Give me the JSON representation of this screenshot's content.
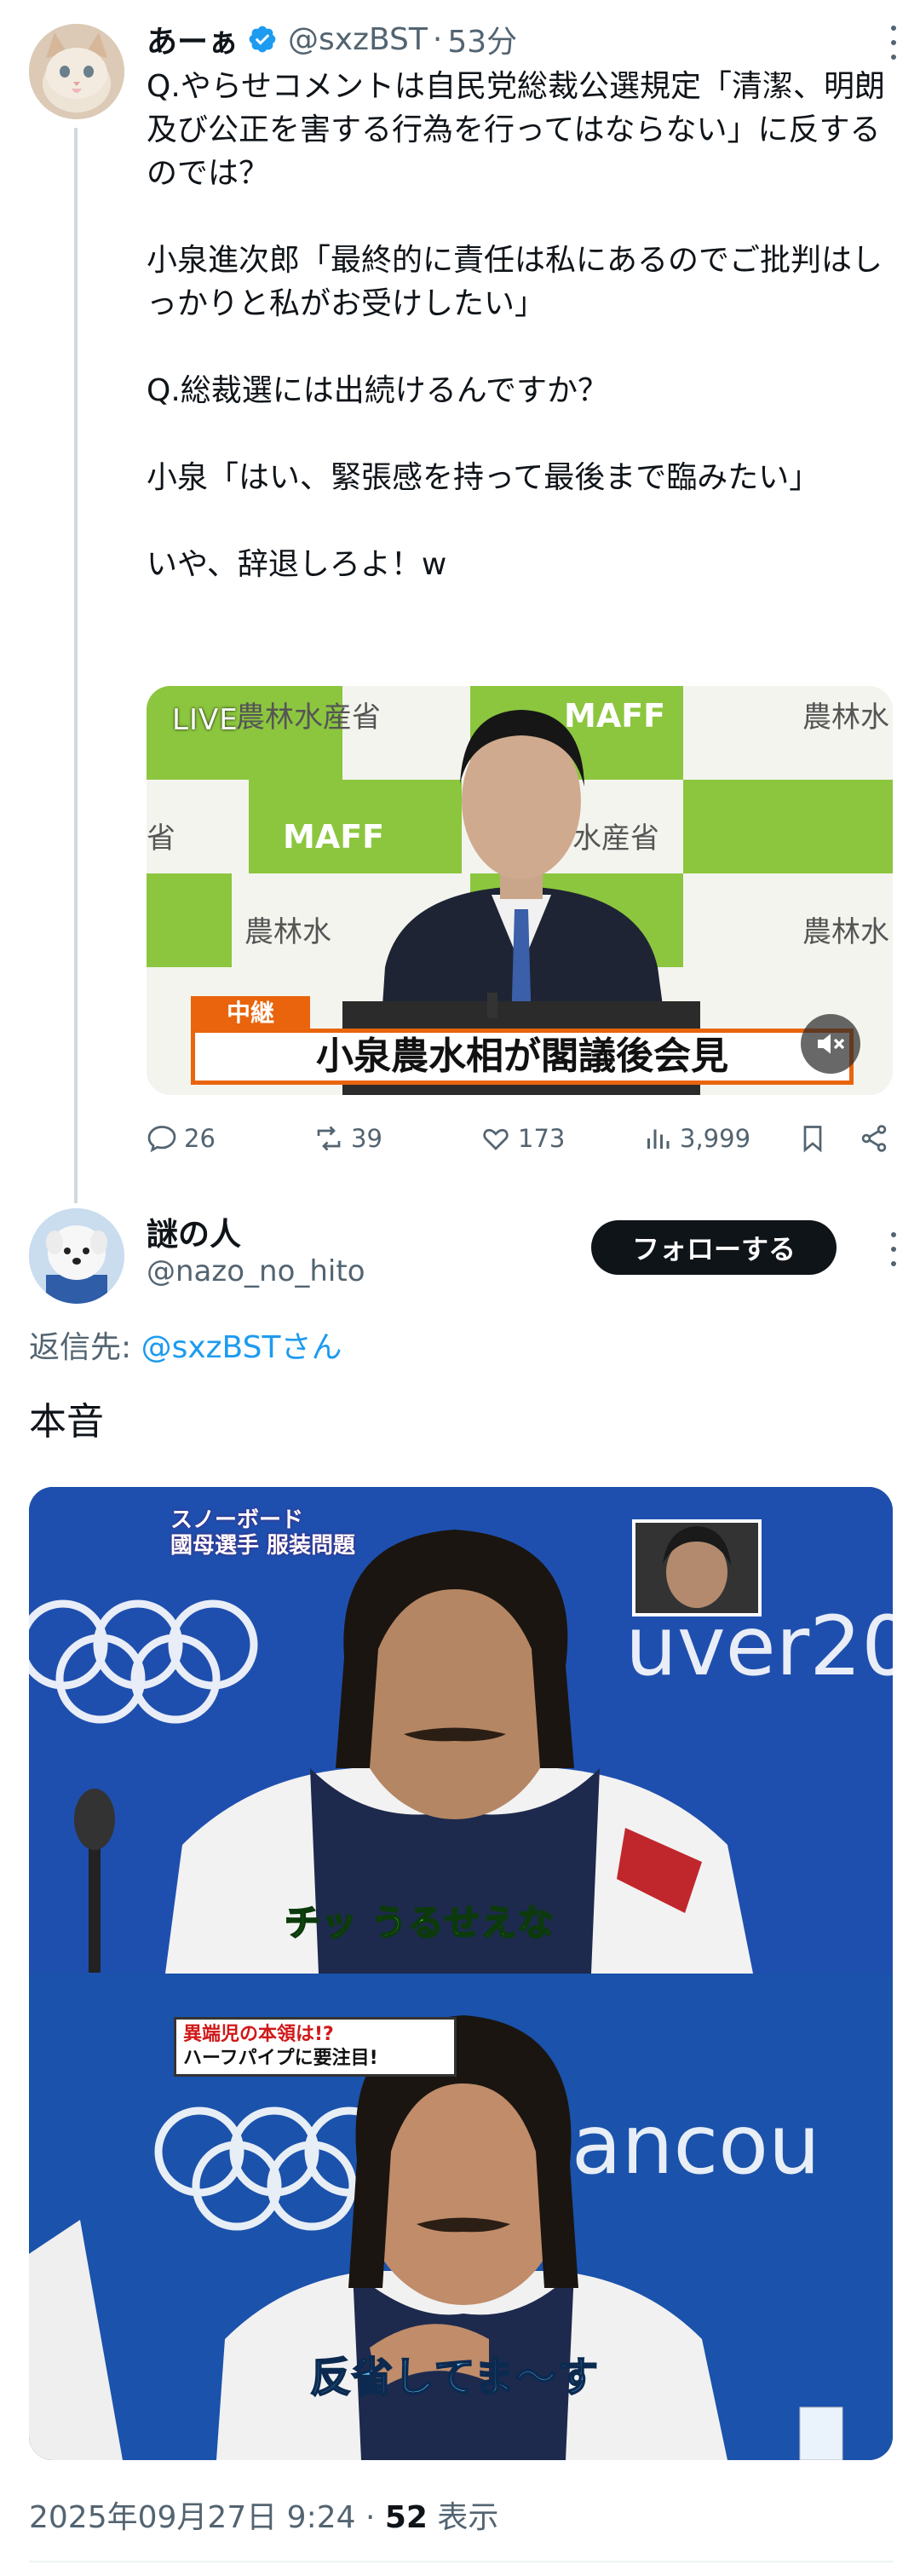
{
  "parent_tweet": {
    "display_name": "あーぁ",
    "handle": "@sxzBST",
    "separator": "·",
    "time": "53分",
    "text": "Q.やらせコメントは自民党総裁公選規定「清潔、明朗及び公正を害する行為を行ってはならない」に反するのでは？\n\n小泉進次郎「最終的に責任は私にあるのでご批判はしっかりと私がお受けしたい」\n\nQ.総裁選には出続けるんですか？\n\n小泉「はい、緊張感を持って最後まで臨みたい」\n\nいや、辞退しろよ！w",
    "video": {
      "live_label": "LIVE",
      "backdrop_text_1": "農林水産省",
      "backdrop_text_2": "MAFF",
      "badge": "中継",
      "caption": "小泉農水相が閣議後会見"
    },
    "stats": {
      "replies": "26",
      "retweets": "39",
      "likes": "173",
      "views": "3,999"
    }
  },
  "reply_tweet": {
    "display_name": "謎の人",
    "handle": "@nazo_no_hito",
    "follow_label": "フォローする",
    "reply_prefix": "返信先: ",
    "reply_mention": "@sxzBSTさん",
    "text": "本音",
    "image": {
      "top_tag": "スノーボード\n國母選手 服装問題",
      "top_subtitle": "チッ うるせえな",
      "bottom_tag_red": "異端児の本領は!?",
      "bottom_tag": "ハーフパイプに要注目!",
      "bottom_subtitle": "反省してま〜す",
      "backdrop_text_1": "uver20",
      "backdrop_text_2": "vancou"
    },
    "footer": {
      "datetime": "2025年09月27日 9:24",
      "separator": " · ",
      "views_count": "52",
      "views_label": " 表示"
    }
  },
  "colors": {
    "verified_blue": "#1d9bf0",
    "secondary_text": "#536471",
    "caption_orange": "#e9640c",
    "maff_green": "#8cc63f"
  }
}
